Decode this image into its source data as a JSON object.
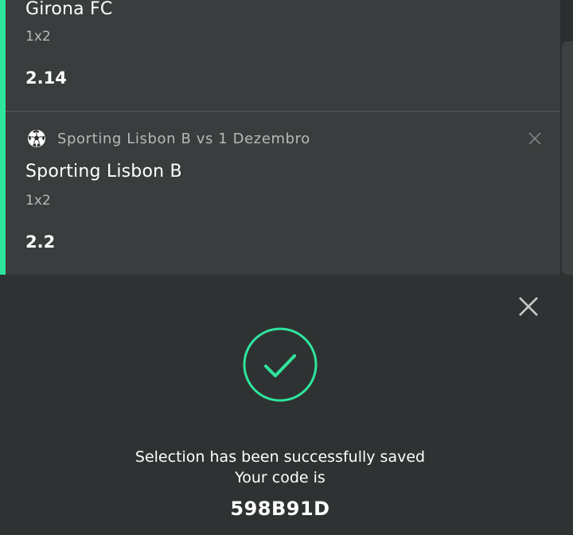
{
  "betslip": {
    "selections": [
      {
        "outcome": "Girona FC",
        "market": "1x2",
        "odds": "2.14"
      },
      {
        "event": "Sporting Lisbon B vs 1 Dezembro",
        "event_icon": "soccer-ball-icon",
        "outcome": "Sporting Lisbon B",
        "market": "1x2",
        "odds": "2.2"
      }
    ]
  },
  "success_modal": {
    "icon": "check-circle-icon",
    "message_line1": "Selection has been successfully saved",
    "message_line2": "Your code is",
    "code": "598B91D"
  },
  "colors": {
    "accent": "#2ee59d",
    "panel": "#3a3d3d",
    "overlay": "#2f3232"
  }
}
